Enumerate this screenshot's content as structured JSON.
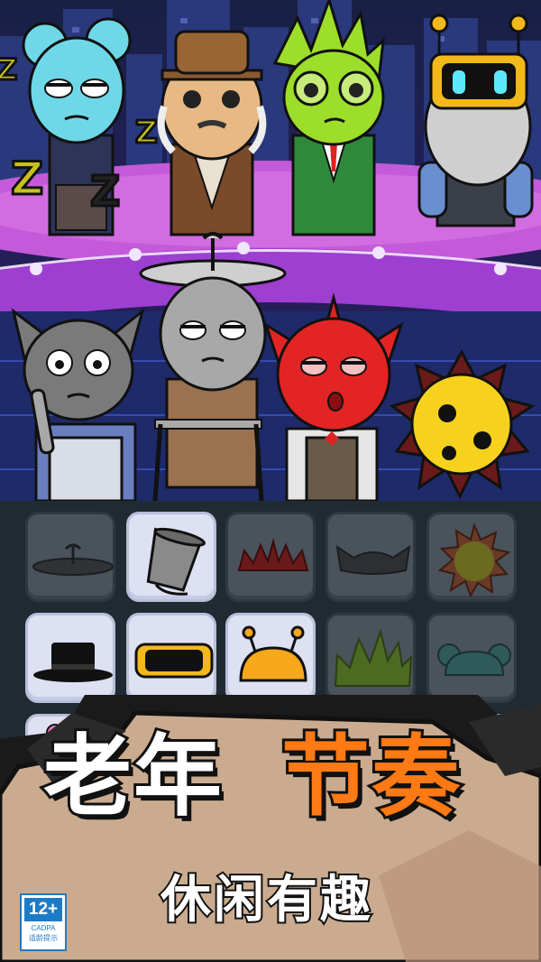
{
  "title": {
    "part1": "老年",
    "part2": "节奏"
  },
  "subtitle": "休闲有趣",
  "age_rating": {
    "badge": "12+",
    "org": "CADPA",
    "note": "适龄提示"
  },
  "stage": {
    "sleep_letters": [
      "Z",
      "Z",
      "Z",
      "Z"
    ],
    "characters_top": [
      "blue-mouse-elder",
      "hat-elder",
      "green-spiky-elder",
      "robot-bearded-elder"
    ],
    "characters_bottom": [
      "gray-cat-elder",
      "propeller-walker-elder",
      "red-devil-elder",
      "yellow-sun-elder"
    ]
  },
  "palette": {
    "rows": [
      [
        {
          "icon": "propeller-hat-icon",
          "state": "locked"
        },
        {
          "icon": "bucket-hat-icon",
          "state": "unlocked"
        },
        {
          "icon": "red-spiked-crown-icon",
          "state": "locked"
        },
        {
          "icon": "cat-ears-icon",
          "state": "locked"
        },
        {
          "icon": "sun-rays-icon",
          "state": "locked"
        }
      ],
      [
        {
          "icon": "top-hat-icon",
          "state": "unlocked"
        },
        {
          "icon": "robot-visor-icon",
          "state": "unlocked"
        },
        {
          "icon": "antenna-dome-icon",
          "state": "unlocked"
        },
        {
          "icon": "green-spikes-icon",
          "state": "locked"
        },
        {
          "icon": "mouse-ears-icon",
          "state": "locked"
        }
      ],
      [
        {
          "icon": "pink-flower-icon",
          "state": "unlocked"
        },
        {
          "icon": "hidden-item-icon",
          "state": "unlocked"
        },
        {
          "icon": "hidden-item-icon",
          "state": "locked"
        },
        {
          "icon": "hidden-item-icon",
          "state": "locked"
        },
        {
          "icon": "pink-flower-icon",
          "state": "unlocked"
        }
      ]
    ]
  },
  "colors": {
    "stage_bg": "#241e5a",
    "platform": "#b14fd8",
    "panel_bg": "#202a33",
    "slot_locked": "#4a525b",
    "slot_unlocked": "#dde1f2",
    "accent_orange": "#ff7a14",
    "banner_paper": "#c9a98d"
  }
}
